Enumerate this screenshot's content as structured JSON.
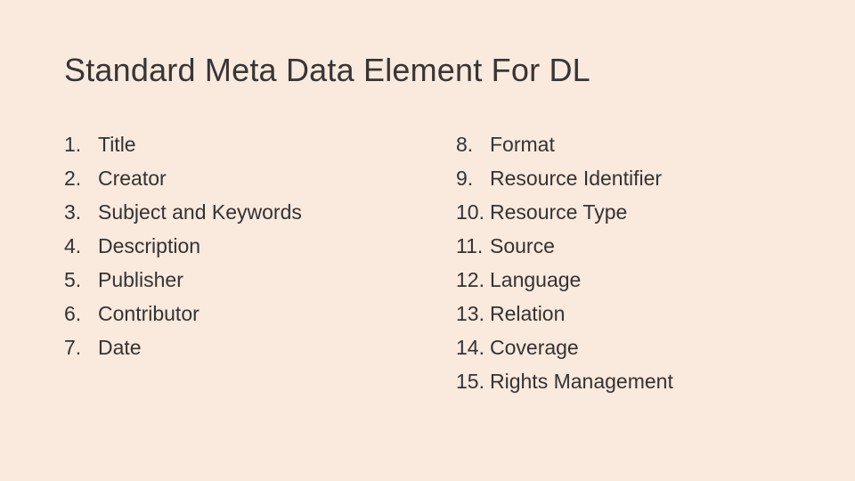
{
  "title": "Standard Meta Data Element For DL",
  "left_items": [
    {
      "n": "1.",
      "label": "Title"
    },
    {
      "n": "2.",
      "label": "Creator"
    },
    {
      "n": "3.",
      "label": "Subject and Keywords"
    },
    {
      "n": "4.",
      "label": "Description"
    },
    {
      "n": "5.",
      "label": "Publisher"
    },
    {
      "n": "6.",
      "label": "Contributor"
    },
    {
      "n": "7.",
      "label": "Date"
    }
  ],
  "right_items": [
    {
      "n": "8.",
      "label": "Format"
    },
    {
      "n": "9.",
      "label": "Resource Identifier"
    },
    {
      "n": "10.",
      "label": "Resource Type"
    },
    {
      "n": "11.",
      "label": "Source"
    },
    {
      "n": "12.",
      "label": "Language"
    },
    {
      "n": "13.",
      "label": "Relation"
    },
    {
      "n": "14.",
      "label": "Coverage"
    },
    {
      "n": "15.",
      "label": "Rights Management"
    }
  ]
}
